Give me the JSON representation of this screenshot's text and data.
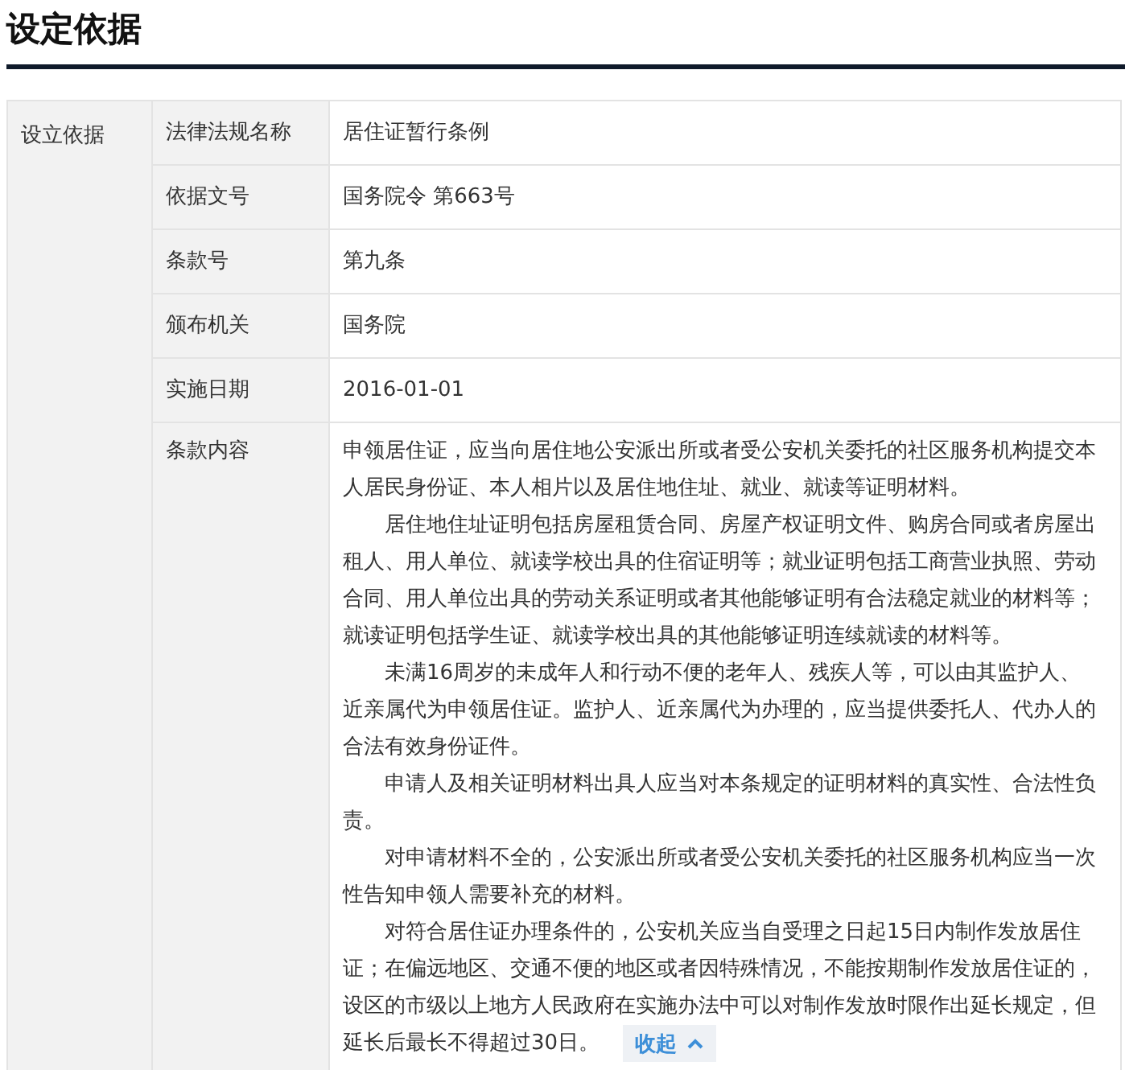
{
  "title": "设定依据",
  "table": {
    "group_label": "设立依据",
    "rows": [
      {
        "label": "法律法规名称",
        "value": "居住证暂行条例"
      },
      {
        "label": "依据文号",
        "value": "国务院令 第663号"
      },
      {
        "label": "条款号",
        "value": "第九条"
      },
      {
        "label": "颁布机关",
        "value": "国务院"
      },
      {
        "label": "实施日期",
        "value": "2016-01-01"
      }
    ],
    "content": {
      "label": "条款内容",
      "paragraphs": [
        {
          "text": "申领居住证，应当向居住地公安派出所或者受公安机关委托的社区服务机构提交本人居民身份证、本人相片以及居住地住址、就业、就读等证明材料。",
          "indented": false
        },
        {
          "text": "居住地住址证明包括房屋租赁合同、房屋产权证明文件、购房合同或者房屋出租人、用人单位、就读学校出具的住宿证明等；就业证明包括工商营业执照、劳动合同、用人单位出具的劳动关系证明或者其他能够证明有合法稳定就业的材料等；就读证明包括学生证、就读学校出具的其他能够证明连续就读的材料等。",
          "indented": true
        },
        {
          "text": "未满16周岁的未成年人和行动不便的老年人、残疾人等，可以由其监护人、近亲属代为申领居住证。监护人、近亲属代为办理的，应当提供委托人、代办人的合法有效身份证件。",
          "indented": true
        },
        {
          "text": "申请人及相关证明材料出具人应当对本条规定的证明材料的真实性、合法性负责。",
          "indented": true
        },
        {
          "text": "对申请材料不全的，公安派出所或者受公安机关委托的社区服务机构应当一次性告知申领人需要补充的材料。",
          "indented": true
        },
        {
          "text": "对符合居住证办理条件的，公安机关应当自受理之日起15日内制作发放居住证；在偏远地区、交通不便的地区或者因特殊情况，不能按期制作发放居住证的，设区的市级以上地方人民政府在实施办法中可以对制作发放时限作出延长规定，但延长后最长不得超过30日。",
          "indented": true
        }
      ],
      "expanded": true,
      "toggle_label": "收起"
    }
  }
}
